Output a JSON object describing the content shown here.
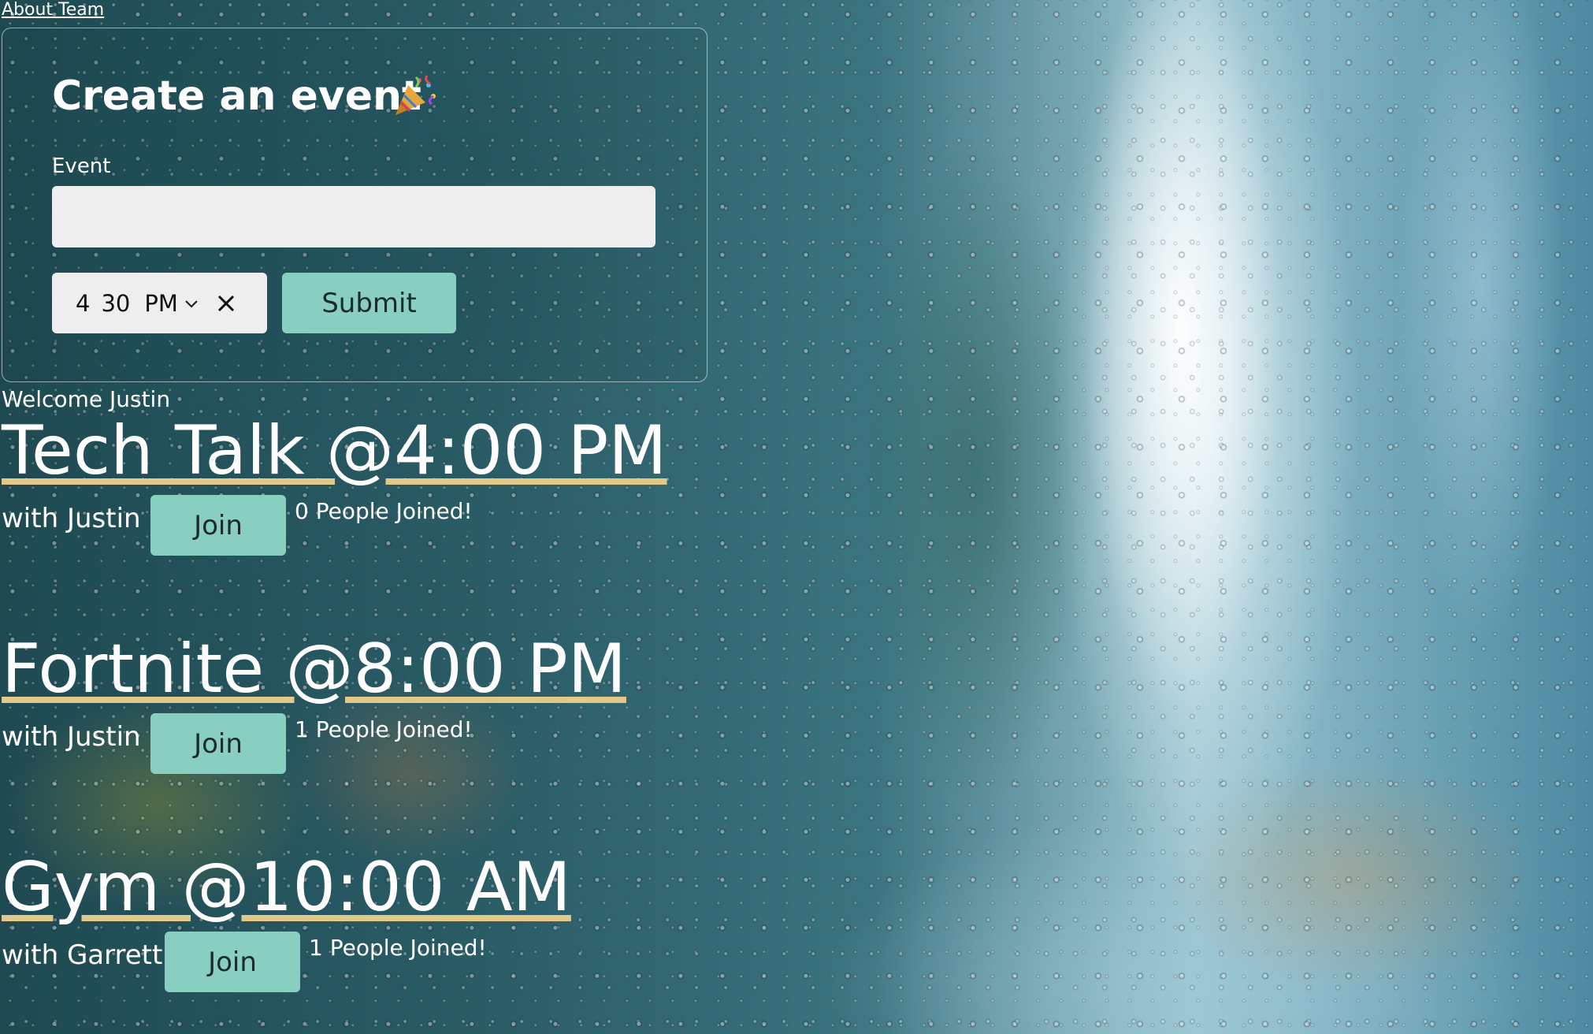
{
  "nav": {
    "about_team": "About Team"
  },
  "form": {
    "title": "Create an event",
    "title_icon": "party-popper-icon",
    "event_label": "Event",
    "event_value": "",
    "time": {
      "hour": "4",
      "minute": "30",
      "ampm": "PM"
    },
    "submit_label": "Submit"
  },
  "welcome": "Welcome Justin",
  "events": [
    {
      "title": "Tech Talk @4:00 PM",
      "host": "with Justin",
      "join_label": "Join",
      "joined": "0 People Joined!"
    },
    {
      "title": "Fortnite @8:00 PM",
      "host": "with Justin",
      "join_label": "Join",
      "joined": "1 People Joined!"
    },
    {
      "title": "Gym @10:00 AM",
      "host": "with Garrett",
      "join_label": "Join",
      "joined": "1 People Joined!"
    }
  ],
  "colors": {
    "button_bg": "#88cfc1",
    "title_underline": "#e2c98a",
    "input_bg": "#eeeeee"
  }
}
